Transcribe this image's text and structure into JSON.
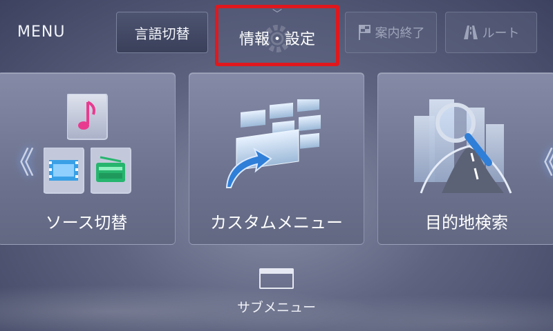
{
  "header": {
    "menu_title": "MENU",
    "buttons": {
      "language": "言語切替",
      "info_settings": "情報・設定",
      "guidance_end": "案内終了",
      "route": "ルート"
    }
  },
  "cards": {
    "source": "ソース切替",
    "custom": "カスタムメニュー",
    "destination": "目的地検索"
  },
  "nav": {
    "left_arrow": "《",
    "right_arrow": "《"
  },
  "submenu": {
    "label": "サブメニュー"
  },
  "colors": {
    "highlight_border": "#e0181d",
    "music_icon": "#e83b8f",
    "video_icon": "#3aa0e6",
    "radio_icon": "#27b56e",
    "accent_blue": "#2f7fd8"
  }
}
